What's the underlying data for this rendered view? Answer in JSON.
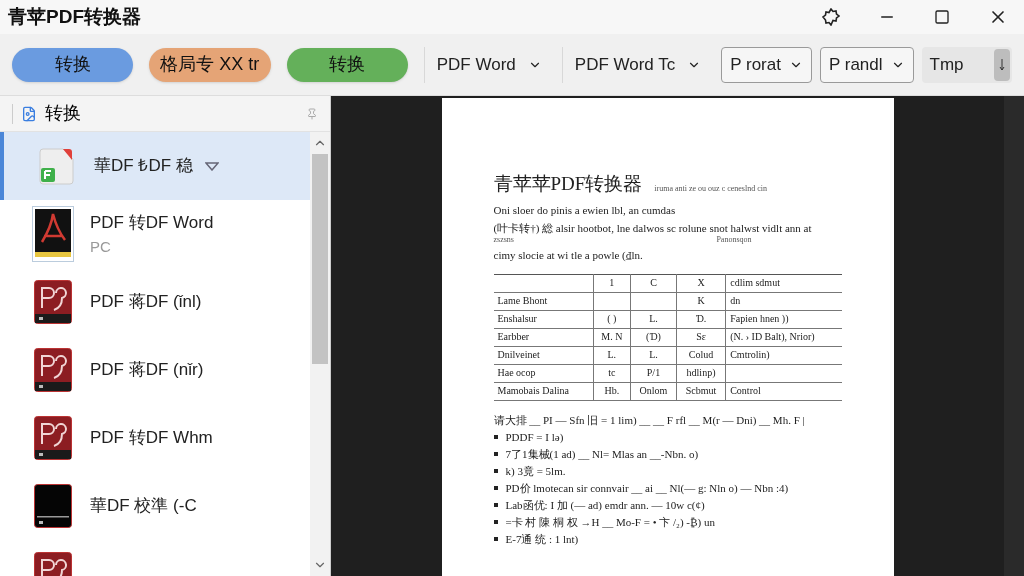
{
  "window": {
    "title": "青苹PDF转换器"
  },
  "toolbar": {
    "buttons": [
      {
        "label": "转换",
        "color": "#6a9be0"
      },
      {
        "label": "格局专 XX tr",
        "color": "#e5a476"
      },
      {
        "label": "转换",
        "color": "#64b05a"
      }
    ],
    "dropdowns": [
      {
        "label": "PDF Word",
        "kind": "plain"
      },
      {
        "label": "PDF Word Tc",
        "kind": "plain"
      },
      {
        "label": "P rorat",
        "kind": "boxed"
      },
      {
        "label": "P randl",
        "kind": "boxed"
      },
      {
        "label": "Tmp",
        "kind": "spinner"
      }
    ]
  },
  "sidebar": {
    "header": "转换",
    "items": [
      {
        "title": "華DF ₺DF 稳",
        "kind": "green",
        "selected": true,
        "expandable": true
      },
      {
        "title": "PDF 转DF Word",
        "subtitle": "PC",
        "kind": "acrobat",
        "selected": false
      },
      {
        "title": "PDF 蒋DF (ǐnl)",
        "kind": "red",
        "selected": false
      },
      {
        "title": "PDF 蒋DF (nǐr)",
        "kind": "red",
        "selected": false
      },
      {
        "title": "PDF 转DF Whm",
        "kind": "red",
        "selected": false
      },
      {
        "title": "華DF 校準 (-C",
        "kind": "black",
        "selected": false
      },
      {
        "kind": "red",
        "selected": false
      }
    ]
  },
  "document": {
    "title": "青苹苹PDF转换器",
    "title_note": "iruma anti ze ou ouz c ceneslnd cin",
    "lines": [
      {
        "text": "Oni sloer do pinis a ewien lbl, an cumdas"
      },
      {
        "text": "(叶卡转†)  総 alsir hootbot, lne dalwos sc rolune snot halwst vidlt ann at",
        "left_note": "zszsns",
        "right_note": "Panonsqon"
      },
      {
        "text": "cimy slocie at wi tle a powle (₫ln."
      }
    ],
    "table": {
      "header": {
        "column_2": "1",
        "column_3": "C",
        "column_4": "X",
        "column_5": "cdlim sdmut"
      },
      "rows": [
        {
          "column_1": "Lame Bhont",
          "column_4": "K",
          "column_5": "dn"
        },
        {
          "column_1": "Enshalsur",
          "column_2": "( )",
          "column_3": "L.",
          "column_4": "Ɗ.",
          "column_5": "Fapien hnen ))"
        },
        {
          "column_1": "Earbber",
          "column_2": "M. N",
          "column_3": "(Ɗ)",
          "column_4": "Sε",
          "column_5": "(N. › ID Balt), Nrior)"
        },
        {
          "column_1": "Dnilveinet",
          "column_2": "L.",
          "column_3": "L.",
          "column_4": "Colud",
          "column_5": "Cmtrolin)"
        },
        {
          "column_1": "Hae ocop",
          "column_2": "tc",
          "column_3": "P/1",
          "column_4": "hdlinp)"
        },
        {
          "column_1": "Mamobais Dalina",
          "column_2": "Hb.",
          "column_3": "Onlom",
          "column_4": "Scbmut",
          "column_5": "Control"
        }
      ]
    },
    "intro": "请大排 __ PI — Sfn 旧 = 1 lim) __ __ F rfl __ M(r — Dni) __ Mh.   F |",
    "bullets": [
      "PDDF = I lǝ)",
      "7了1集械(1 ad)      __ Nl= Mlas an __-Nbn. o)",
      "k) 3竟 = 5lm.",
      "PD价 lmotecan sir connvair __ ai __ Nl(— g: Nln o) — Nbn :4)",
      "Lab函优: I 加 (— ad)     emdr ann. — 10w c(¢)",
      "=卡 村 陳 桐 权 →H     __ Mo-F = • 卞 /₂) -₿)     un",
      "E-7通 统 : 1 lnt)"
    ]
  }
}
